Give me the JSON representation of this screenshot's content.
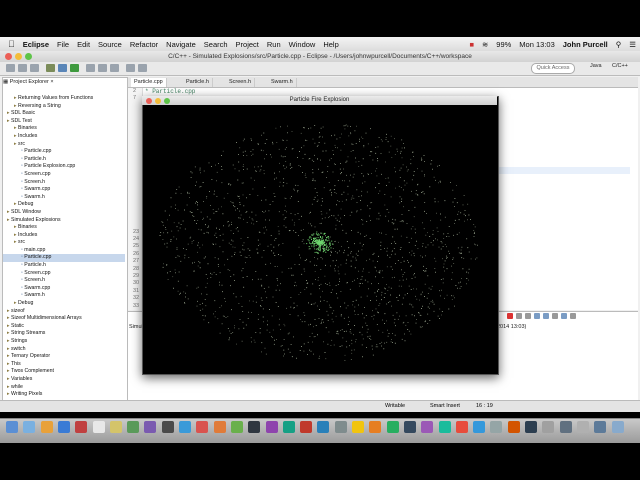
{
  "menubar": {
    "app": "Eclipse",
    "items": [
      "File",
      "Edit",
      "Source",
      "Refactor",
      "Navigate",
      "Search",
      "Project",
      "Run",
      "Window",
      "Help"
    ],
    "battery": "99%",
    "clock": "Mon 13:03",
    "user": "John Purcell"
  },
  "window": {
    "title": "C/C++ - Simulated Explosions/src/Particle.cpp - Eclipse - /Users/johnwpurcell/Documents/C++/workspace"
  },
  "toolbar": {
    "quick_access": "Quick Access",
    "perspectives": [
      "Java",
      "C/C++"
    ]
  },
  "project_explorer": {
    "tab": "Project Explorer",
    "items": [
      {
        "label": "Returning Values from Functions",
        "indent": 1
      },
      {
        "label": "Reversing a String",
        "indent": 1
      },
      {
        "label": "SDL Basic",
        "indent": 0
      },
      {
        "label": "SDL Test",
        "indent": 0
      },
      {
        "label": "Binaries",
        "indent": 1
      },
      {
        "label": "Includes",
        "indent": 1
      },
      {
        "label": "src",
        "indent": 1
      },
      {
        "label": "Particle.cpp",
        "indent": 2
      },
      {
        "label": "Particle.h",
        "indent": 2
      },
      {
        "label": "Particle Explosion.cpp",
        "indent": 2
      },
      {
        "label": "Screen.cpp",
        "indent": 2
      },
      {
        "label": "Screen.h",
        "indent": 2
      },
      {
        "label": "Swarm.cpp",
        "indent": 2
      },
      {
        "label": "Swarm.h",
        "indent": 2
      },
      {
        "label": "Debug",
        "indent": 1
      },
      {
        "label": "SDL Window",
        "indent": 0
      },
      {
        "label": "Simulated Explosions",
        "indent": 0
      },
      {
        "label": "Binaries",
        "indent": 1
      },
      {
        "label": "Includes",
        "indent": 1
      },
      {
        "label": "src",
        "indent": 1
      },
      {
        "label": "main.cpp",
        "indent": 2
      },
      {
        "label": "Particle.cpp",
        "indent": 2,
        "selected": true
      },
      {
        "label": "Particle.h",
        "indent": 2
      },
      {
        "label": "Screen.cpp",
        "indent": 2
      },
      {
        "label": "Screen.h",
        "indent": 2
      },
      {
        "label": "Swarm.cpp",
        "indent": 2
      },
      {
        "label": "Swarm.h",
        "indent": 2
      },
      {
        "label": "Debug",
        "indent": 1
      },
      {
        "label": "sizeof",
        "indent": 0
      },
      {
        "label": "Sizeof Multidimensional Arrays",
        "indent": 0
      },
      {
        "label": "Static",
        "indent": 0
      },
      {
        "label": "String Streams",
        "indent": 0
      },
      {
        "label": "Strings",
        "indent": 0
      },
      {
        "label": "switch",
        "indent": 0
      },
      {
        "label": "Ternary Operator",
        "indent": 0
      },
      {
        "label": "This",
        "indent": 0
      },
      {
        "label": "Twos Complement",
        "indent": 0
      },
      {
        "label": "Variables",
        "indent": 0
      },
      {
        "label": "while",
        "indent": 0
      },
      {
        "label": "Writing Pixels",
        "indent": 0
      }
    ]
  },
  "editor": {
    "tabs": [
      "Particle.cpp",
      "Particle.h",
      "Screen.h",
      "Swarm.h"
    ],
    "active_tab": 0,
    "line1": "* Particle.cpp",
    "line_numbers": [
      "2",
      "7",
      "",
      "",
      "",
      "",
      "",
      "",
      "",
      "",
      "",
      "",
      "",
      "",
      "",
      "",
      "",
      "",
      "",
      "23",
      "24",
      "25",
      "26",
      "27",
      "28",
      "29",
      "30",
      "31",
      "32",
      "33"
    ]
  },
  "console": {
    "label": "Simul",
    "right_text": "2014 13:03)"
  },
  "statusbar": {
    "writable": "Writable",
    "insert_mode": "Smart Insert",
    "position": "16 : 19"
  },
  "particle_window": {
    "title": "Particle Fire Explosion"
  },
  "colors": {
    "particle_core": "#6fd66f",
    "particle_field": "#d8e8c8",
    "background": "#000000"
  }
}
